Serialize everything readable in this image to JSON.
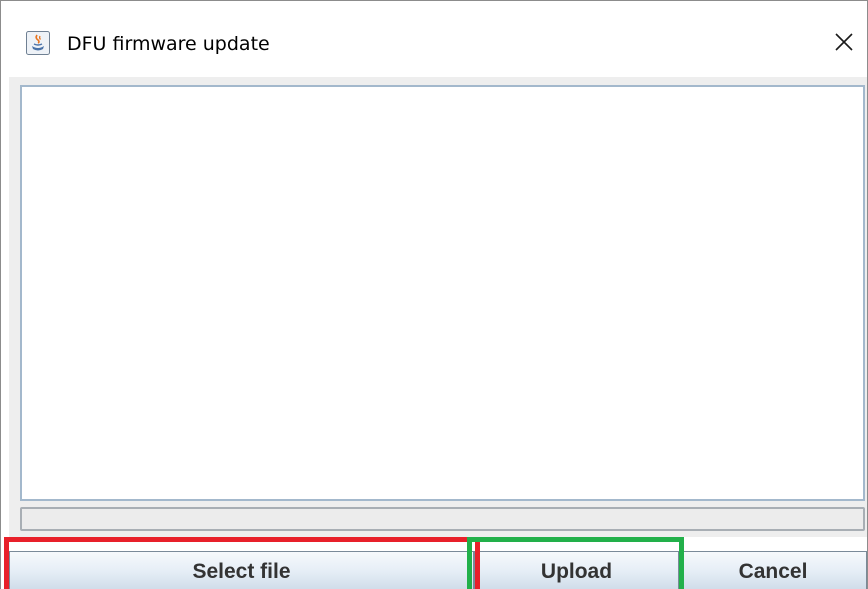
{
  "window": {
    "title": "DFU firmware update",
    "app_icon": "java-cup-icon",
    "close_icon": "close-icon"
  },
  "log": {
    "text": ""
  },
  "progress": {
    "value": 0
  },
  "buttons": {
    "select_file": "Select file",
    "upload": "Upload",
    "cancel": "Cancel"
  },
  "highlights": {
    "select_color": "#e8202a",
    "upload_color": "#22b04a"
  }
}
